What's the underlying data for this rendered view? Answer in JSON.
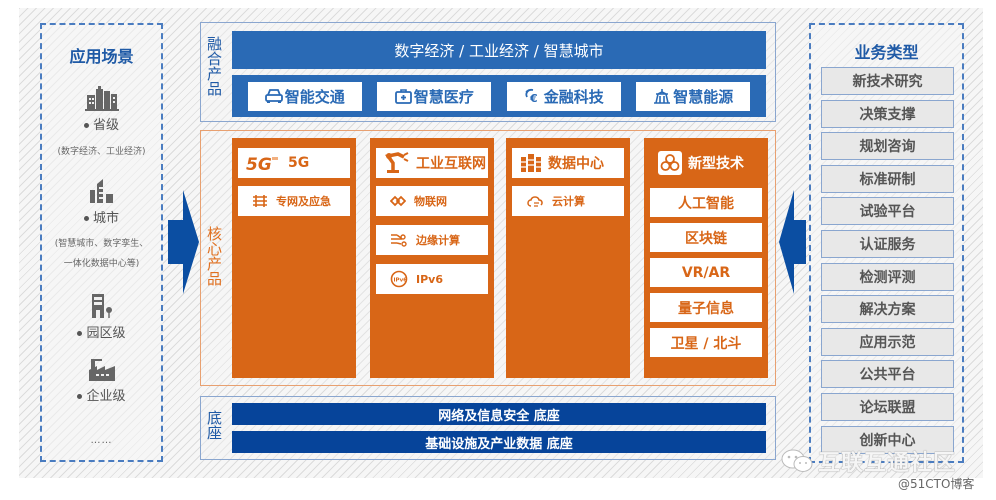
{
  "left_panel": {
    "title": "应用场景",
    "scenes": [
      {
        "icon": "buildings-icon",
        "label": "省级",
        "note_lines": [
          "(数字经济、工业经济)"
        ]
      },
      {
        "icon": "city-icon",
        "label": "城市",
        "note_lines": [
          "(智慧城市、数字孪生、",
          "一体化数据中心等)"
        ]
      },
      {
        "icon": "park-icon",
        "label": "园区级",
        "note_lines": []
      },
      {
        "icon": "factory-icon",
        "label": "企业级",
        "note_lines": []
      }
    ],
    "ellipsis": "……"
  },
  "fusion": {
    "side_label": "融合产品",
    "banner": "数字经济 / 工业经济 / 智慧城市",
    "items": [
      {
        "icon": "car-icon",
        "label": "智能交通"
      },
      {
        "icon": "medical-kit-icon",
        "label": "智慧医疗"
      },
      {
        "icon": "finance-icon",
        "label": "金融科技"
      },
      {
        "icon": "energy-tower-icon",
        "label": "智慧能源"
      }
    ]
  },
  "core": {
    "side_label": "核心产品",
    "columns": [
      {
        "icon": "5g-logo-icon",
        "title": "5G",
        "subs": [
          {
            "icon": "private-network-icon",
            "label": "专网及应急"
          }
        ]
      },
      {
        "icon": "robot-arm-icon",
        "title": "工业互联网",
        "subs": [
          {
            "icon": "iot-icon",
            "label": "物联网"
          },
          {
            "icon": "edge-computing-icon",
            "label": "边缘计算"
          },
          {
            "icon": "ipv6-globe-icon",
            "label": "IPv6"
          }
        ]
      },
      {
        "icon": "server-rack-icon",
        "title": "数据中心",
        "subs": [
          {
            "icon": "cloud-icon",
            "label": "云计算"
          }
        ]
      },
      {
        "icon": "tech-circles-icon",
        "title": "新型技术",
        "techs": [
          "人工智能",
          "区块链",
          "VR/AR",
          "量子信息",
          "卫星 / 北斗"
        ]
      }
    ]
  },
  "base": {
    "side_label": "底座",
    "bars": [
      "网络及信息安全 底座",
      "基础设施及产业数据 底座"
    ]
  },
  "right_panel": {
    "title": "业务类型",
    "items": [
      "新技术研究",
      "决策支撑",
      "规划咨询",
      "标准研制",
      "试验平台",
      "认证服务",
      "检测评测",
      "解决方案",
      "应用示范",
      "公共平台",
      "论坛联盟",
      "创新中心"
    ]
  },
  "watermark": {
    "text": "互联互通社区",
    "credit": "@51CTO博客"
  },
  "colors": {
    "blue": "#2a6ab5",
    "dark_blue": "#06449a",
    "orange": "#d86617",
    "title_blue": "#1f5aa6"
  }
}
